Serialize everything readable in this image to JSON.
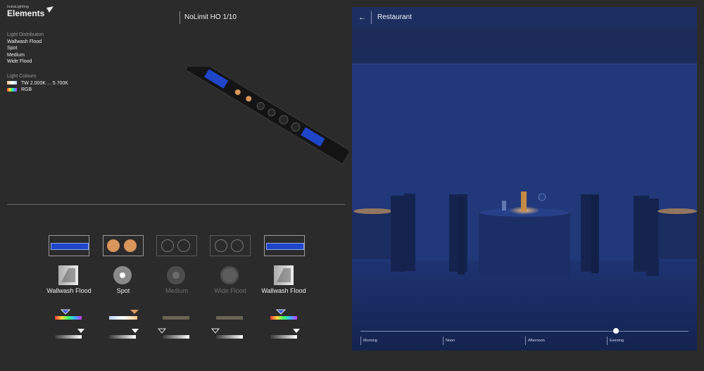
{
  "brand": {
    "small": "InstaLighting",
    "name": "Elements"
  },
  "spec": {
    "distribution_heading": "Light Distribution",
    "distributions": [
      "Wallwash Flood",
      "Spot",
      "Medium",
      "Wide Flood"
    ],
    "colours_heading": "Light Colours",
    "colours": [
      "TW 2.000K ... 5.700K",
      "RGB"
    ]
  },
  "product": {
    "title": "NoLimit HO 1/10"
  },
  "modules": [
    {
      "label": "Wallwash Flood",
      "active": true,
      "type": "wallwash"
    },
    {
      "label": "Spot",
      "active": true,
      "type": "spot"
    },
    {
      "label": "Medium",
      "active": false,
      "type": "medium"
    },
    {
      "label": "Wide Flood",
      "active": false,
      "type": "wide"
    },
    {
      "label": "Wallwash Flood",
      "active": true,
      "type": "wallwash"
    }
  ],
  "scene": {
    "title": "Restaurant",
    "back_icon": "arrow-left-icon",
    "time_level": 0.78
  },
  "timeline": {
    "labels": [
      "Morning",
      "Noon",
      "Afternoon",
      "Evening"
    ]
  },
  "colors": {
    "accent_blue": "#1f45c8",
    "warm": "#d9955a",
    "scene_bg": "#1c2c5a"
  }
}
